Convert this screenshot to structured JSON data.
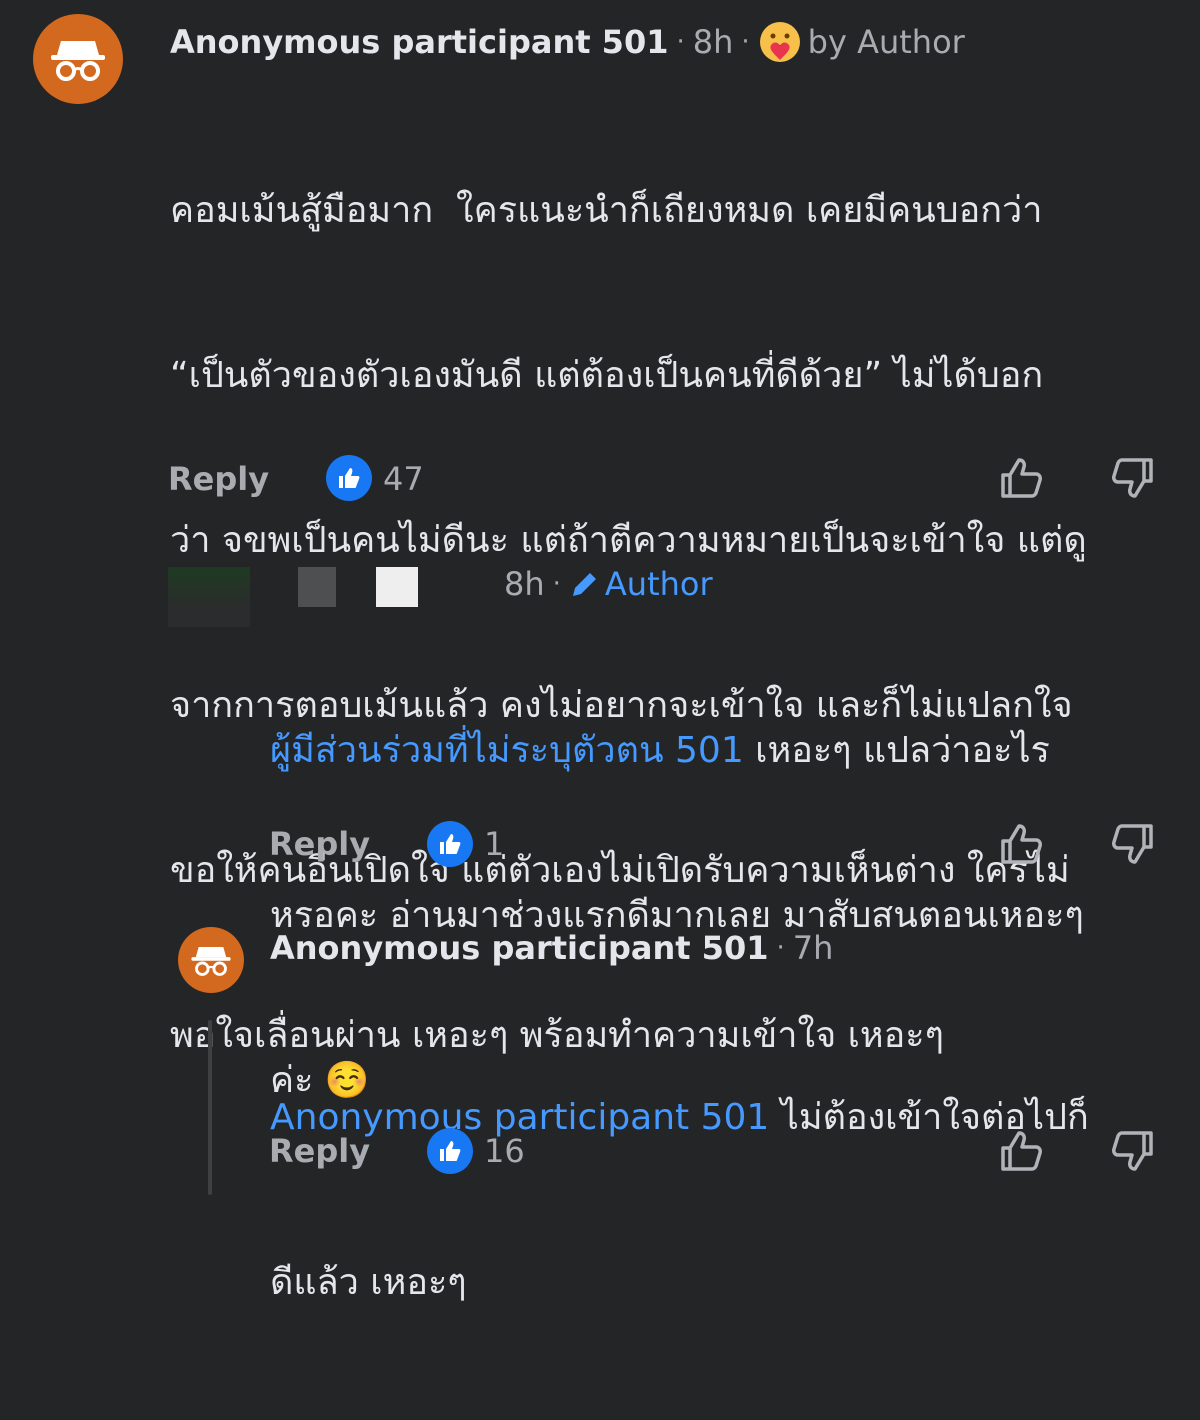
{
  "comment1": {
    "author": "Anonymous participant 501",
    "separator": "·",
    "time": "8h",
    "badge_label": "by Author",
    "lines": [
      "คอมเม้นสู้มือมาก  ใครแนะนำก็เถียงหมด เคยมีคนบอกว่า",
      "“เป็นตัวของตัวเองมันดี แต่ต้องเป็นคนที่ดีด้วย” ไม่ได้บอก",
      "ว่า จขพเป็นคนไม่ดีนะ แต่ถ้าตีความหมายเป็นจะเข้าใจ แต่ดู",
      "จากการตอบเม้นแล้ว คงไม่อยากจะเข้าใจ และก็ไม่แปลกใจ",
      "ขอให้คนอื่นเปิดใจ แต่ตัวเองไม่เปิดรับความเห็นต่าง ใครไม่",
      "พอใจเลื่อนผ่าน เหอะๆ พร้อมทำความเข้าใจ เหอะๆ"
    ],
    "reply_label": "Reply",
    "like_count": "47"
  },
  "comment2": {
    "time": "8h",
    "separator": "·",
    "badge_label": "Author",
    "mention": "ผู้มีส่วนร่วมที่ไม่ระบุตัวตน 501",
    "line1_rest": " เหอะๆ แปลว่าอะไร",
    "line2": "หรอคะ อ่านมาช่วงแรกดีมากเลย มาสับสนตอนเหอะๆ",
    "line3": "ค่ะ ☺️",
    "reply_label": "Reply",
    "like_count": "1"
  },
  "comment3": {
    "author": "Anonymous participant 501",
    "separator": "·",
    "time": "7h",
    "mention": "Anonymous participant 501",
    "line1_rest": " ไม่ต้องเข้าใจต่อไปก็",
    "line2": "ดีแล้ว เหอะๆ",
    "reply_label": "Reply",
    "like_count": "16"
  },
  "colors": {
    "background": "#242526",
    "text": "#e4e6eb",
    "muted": "#a8abaf",
    "mention": "#4599ff",
    "like_blue": "#1877f2",
    "avatar": "#d2691e"
  }
}
